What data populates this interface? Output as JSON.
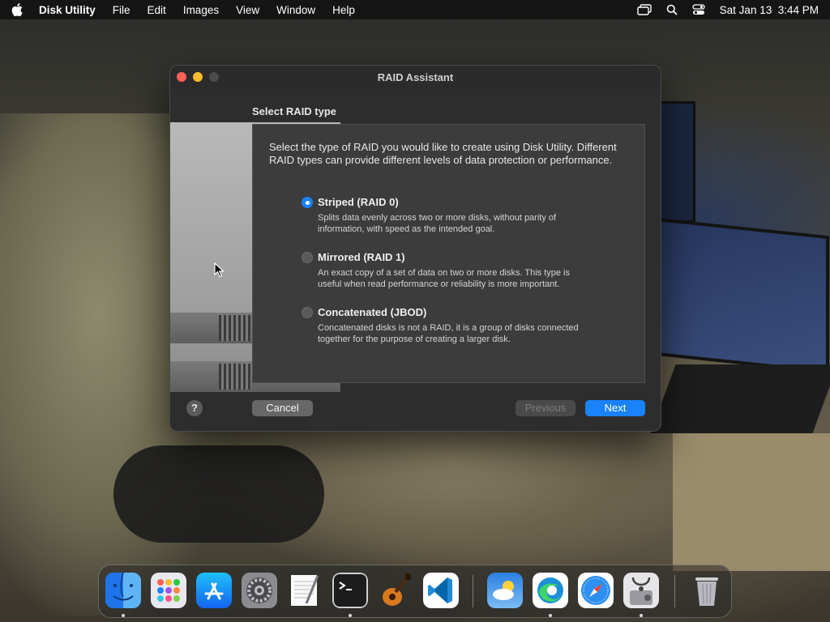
{
  "menubar": {
    "app_name": "Disk Utility",
    "menus": [
      "File",
      "Edit",
      "Images",
      "View",
      "Window",
      "Help"
    ],
    "clock": "Sat Jan 13  3:44 PM",
    "status_icons": [
      "screen-mirroring-icon",
      "spotlight-search-icon",
      "control-center-icon"
    ]
  },
  "window": {
    "title": "RAID Assistant",
    "section_title": "Select RAID type",
    "intro": "Select the type of RAID you would like to create using Disk Utility. Different RAID types can provide different levels of data protection or performance.",
    "options": [
      {
        "label": "Striped (RAID 0)",
        "description": "Splits data evenly across two or more disks, without parity of information, with speed as the intended goal.",
        "selected": true
      },
      {
        "label": "Mirrored (RAID 1)",
        "description": "An exact copy of a set of data on two or more disks. This type is useful when read performance or reliability is more important.",
        "selected": false
      },
      {
        "label": "Concatenated (JBOD)",
        "description": "Concatenated disks is not a RAID, it is a group of disks connected together for the purpose of creating a larger disk.",
        "selected": false
      }
    ],
    "help": "?",
    "cancel": "Cancel",
    "previous": "Previous",
    "next": "Next"
  },
  "colors": {
    "accent": "#1a82fb",
    "close": "#fe5f57",
    "minimize": "#febc2e"
  },
  "dock": {
    "apps": [
      "finder-icon",
      "launchpad-icon",
      "app-store-icon",
      "system-settings-icon",
      "textedit-icon",
      "terminal-icon",
      "garageband-icon",
      "vscode-icon",
      "weather-icon",
      "edge-icon",
      "safari-icon",
      "disk-utility-icon",
      "trash-icon"
    ]
  }
}
